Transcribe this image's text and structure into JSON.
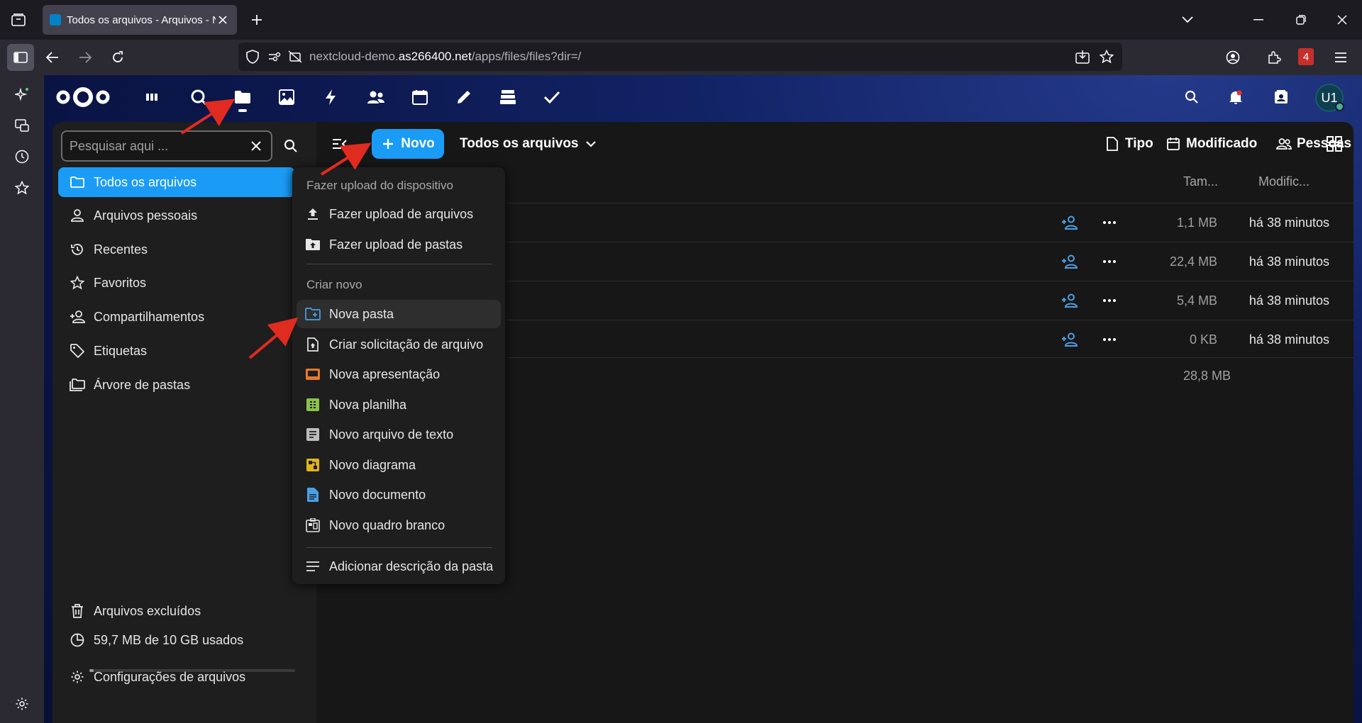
{
  "browser": {
    "tab_title": "Todos os arquivos - Arquivos - N",
    "url_prefix": "nextcloud-demo.",
    "url_domain": "as266400.net",
    "url_path": "/apps/files/files?dir=/",
    "extension_badge": "4"
  },
  "header": {
    "apps": [
      "dashboard-icon",
      "search-circle-icon",
      "files-icon",
      "photos-icon",
      "activity-icon",
      "contacts-icon",
      "calendar-icon",
      "notes-icon",
      "deck-icon",
      "tasks-icon"
    ],
    "avatar_initials": "U1"
  },
  "sidebar": {
    "search_placeholder": "Pesquisar aqui ...",
    "items": [
      {
        "label": "Todos os arquivos",
        "icon": "folder-icon"
      },
      {
        "label": "Arquivos pessoais",
        "icon": "account-icon"
      },
      {
        "label": "Recentes",
        "icon": "history-icon"
      },
      {
        "label": "Favoritos",
        "icon": "star-icon"
      },
      {
        "label": "Compartilhamentos",
        "icon": "share-icon"
      },
      {
        "label": "Etiquetas",
        "icon": "tag-icon"
      },
      {
        "label": "Árvore de pastas",
        "icon": "folder-tree-icon"
      }
    ],
    "deleted_label": "Arquivos excluídos",
    "quota_label": "59,7 MB de 10 GB usados",
    "quota_fraction": 0.006,
    "settings_label": "Configurações de arquivos"
  },
  "toolbar": {
    "new_label": "Novo",
    "breadcrumb": "Todos os arquivos",
    "filters": [
      "Tipo",
      "Modificado",
      "Pessoas"
    ]
  },
  "table": {
    "col_size": "Tam...",
    "col_modified": "Modific...",
    "rows": [
      {
        "size": "1,1 MB",
        "modified": "há 38 minutos"
      },
      {
        "size": "22,4 MB",
        "modified": "há 38 minutos"
      },
      {
        "size": "5,4 MB",
        "modified": "há 38 minutos"
      },
      {
        "size": "0 KB",
        "modified": "há 38 minutos"
      }
    ],
    "total_size": "28,8 MB"
  },
  "menu": {
    "caption_upload": "Fazer upload do dispositivo",
    "upload_files": "Fazer upload de arquivos",
    "upload_folders": "Fazer upload de pastas",
    "caption_create": "Criar novo",
    "items": [
      {
        "label": "Nova pasta",
        "icon": "folder-plus-icon"
      },
      {
        "label": "Criar solicitação de arquivo",
        "icon": "file-request-icon"
      },
      {
        "label": "Nova apresentação",
        "icon": "presentation-icon"
      },
      {
        "label": "Nova planilha",
        "icon": "spreadsheet-icon"
      },
      {
        "label": "Novo arquivo de texto",
        "icon": "text-file-icon"
      },
      {
        "label": "Novo diagrama",
        "icon": "diagram-icon"
      },
      {
        "label": "Novo documento",
        "icon": "document-icon"
      },
      {
        "label": "Novo quadro branco",
        "icon": "whiteboard-icon"
      }
    ],
    "add_description": "Adicionar descrição da pasta"
  },
  "colors": {
    "accent": "#1a9cf6",
    "annotation_arrow": "#e02b20",
    "presentation": "#e8782f",
    "spreadsheet": "#8bc34a",
    "diagram": "#e0b41c",
    "document": "#4aa0e6"
  }
}
